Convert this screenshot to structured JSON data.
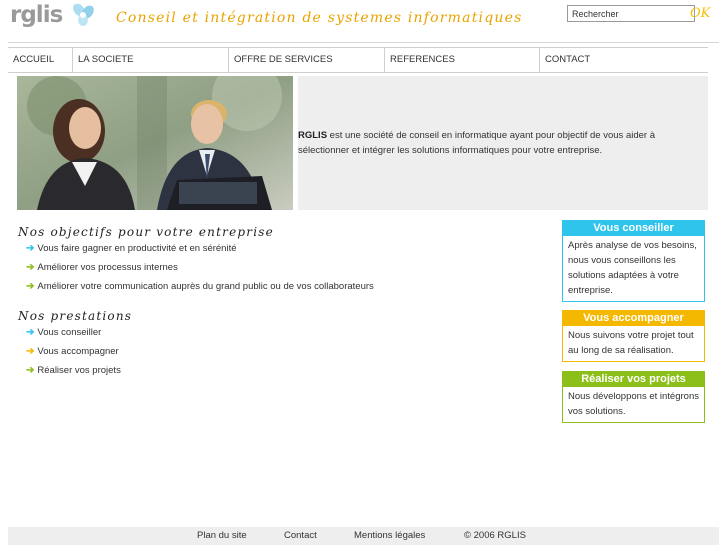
{
  "header": {
    "logo_text": "rglis",
    "slogan": "Conseil et intégration de systemes informatiques",
    "search_value": "Rechercher",
    "search_button": "OK"
  },
  "nav": {
    "items": [
      "ACCUEIL",
      "LA SOCIETE",
      "OFFRE DE SERVICES",
      "REFERENCES",
      "CONTACT"
    ]
  },
  "hero": {
    "brand": "RGLIS",
    "text": " est une société de conseil en informatique ayant pour objectif de vous aider à sélectionner et intégrer les solutions informatiques pour votre entreprise."
  },
  "objectives": {
    "title": "Nos objectifs pour votre entreprise",
    "items": [
      "Vous faire gagner en productivité et en sérénité",
      "Améliorer vos processus internes",
      "Améliorer votre communication auprès du grand public ou de vos collaborateurs"
    ]
  },
  "services": {
    "title": "Nos prestations",
    "items": [
      "Vous conseiller",
      "Vous accompagner",
      "Réaliser vos projets"
    ]
  },
  "boxes": [
    {
      "title": "Vous conseiller",
      "body": "Après analyse de vos besoins, nous vous conseillons les solutions adaptées à votre entreprise.",
      "color": "#2ec4ec"
    },
    {
      "title": "Vous accompagner",
      "body": "Nous suivons votre projet tout au long de sa réalisation.",
      "color": "#f5b800"
    },
    {
      "title": "Réaliser vos projets",
      "body": "Nous développons et intégrons vos solutions.",
      "color": "#8cbf1a"
    }
  ],
  "footer": {
    "sitemap": "Plan du site",
    "contact": "Contact",
    "legal": "Mentions légales",
    "copyright": "© 2006 RGLIS"
  },
  "colors": {
    "cyan": "#2ec4ec",
    "orange": "#f5b800",
    "green": "#8cbf1a",
    "slogan": "#e8a400"
  }
}
